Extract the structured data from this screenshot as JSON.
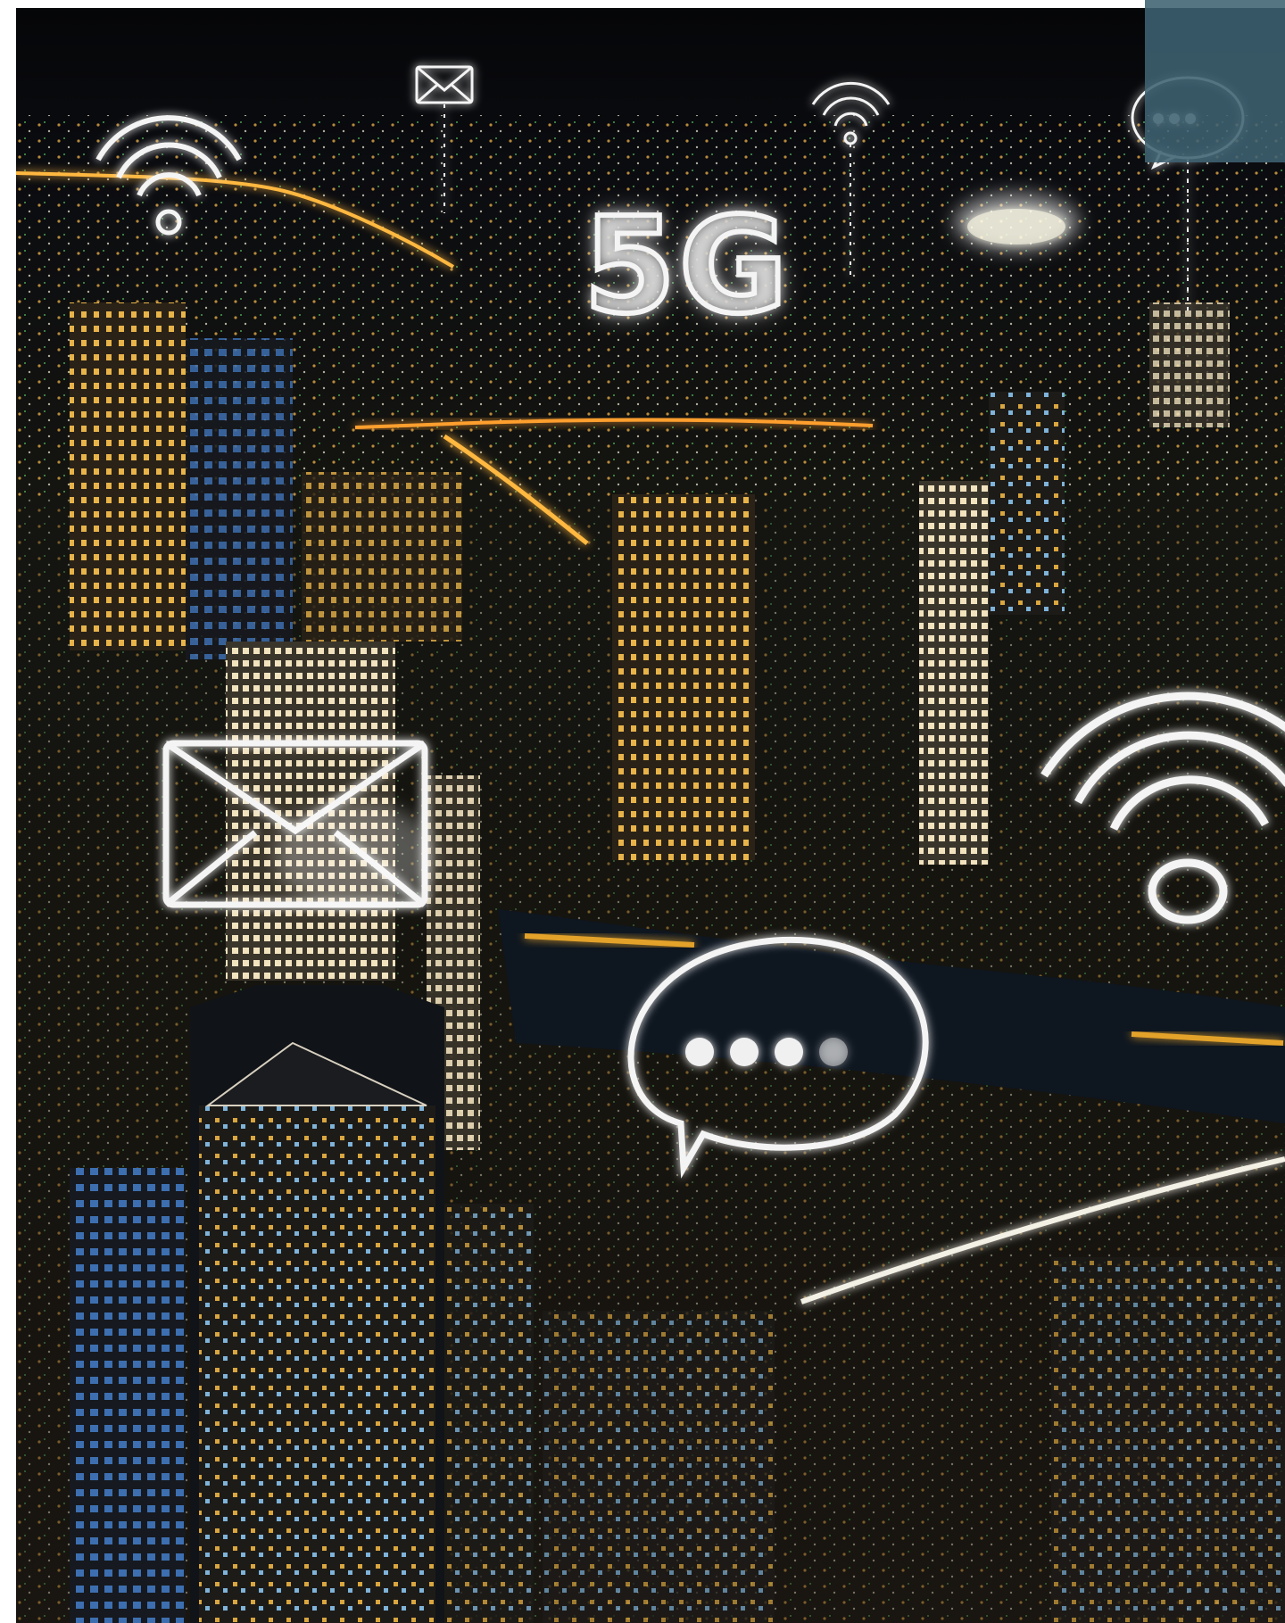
{
  "scene": {
    "headline": "5G",
    "icons": [
      "envelope-icon",
      "wifi-icon",
      "speech-bubble-icon",
      "cloud-icon"
    ]
  },
  "colors": {
    "sky": "#050608",
    "city_lights": "#ffb840",
    "river_glow": "#e3a229",
    "neon_outline": "#f4f4f4",
    "corner_panel": "#3f6272"
  }
}
